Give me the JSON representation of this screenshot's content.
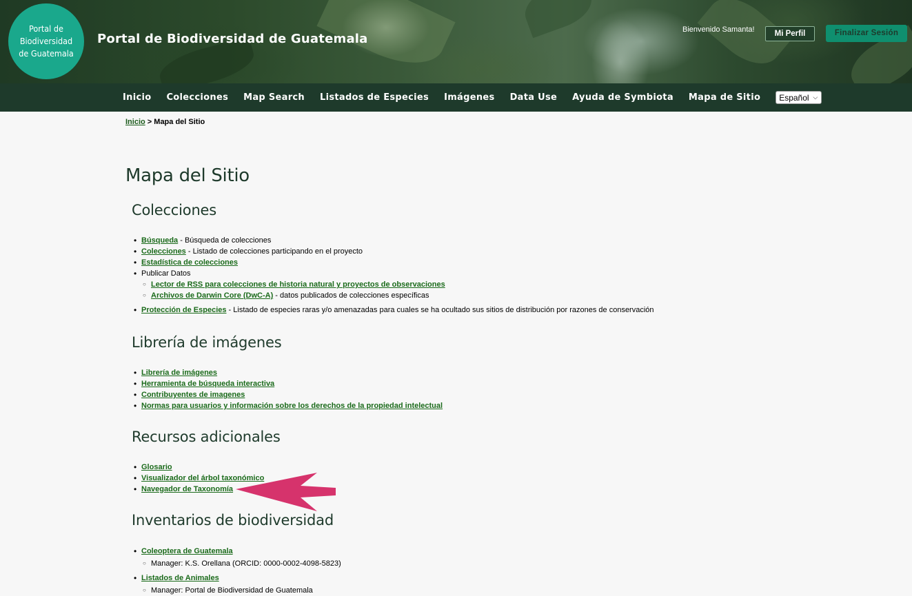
{
  "header": {
    "logo_text": "Portal de\nBiodiversidad\nde Guatemala",
    "site_title": "Portal de Biodiversidad de Guatemala",
    "welcome": "Bienvenido Samanta!",
    "profile_button": "Mi Perfil",
    "logout_button": "Finalizar Sesión"
  },
  "nav": {
    "items": [
      "Inicio",
      "Colecciones",
      "Map Search",
      "Listados de Especies",
      "Imágenes",
      "Data Use",
      "Ayuda de Symbiota",
      "Mapa de Sitio"
    ],
    "language": "Español"
  },
  "breadcrumb": {
    "home": "Inicio",
    "separator": " > ",
    "current": "Mapa del Sitio"
  },
  "page_title": "Mapa del Sitio",
  "sections": {
    "colecciones": {
      "title": "Colecciones",
      "busqueda": {
        "link": "Búsqueda",
        "desc": " - Búsqueda de colecciones"
      },
      "colecciones": {
        "link": "Colecciones",
        "desc": " - Listado de colecciones participando en el proyecto"
      },
      "estadistica": {
        "link": "Estadística de colecciones"
      },
      "publicar": "Publicar Datos",
      "rss": {
        "link": "Lector de RSS para colecciones de historia natural y proyectos de observaciones"
      },
      "dwca": {
        "link": "Archivos de Darwin Core (DwC-A)",
        "desc": " - datos publicados de colecciones específicas"
      },
      "proteccion": {
        "link": "Protección de Especies",
        "desc": " - Listado de especies raras y/o amenazadas para cuales se ha ocultado sus sitios de distribución por razones de conservación"
      }
    },
    "imagenes": {
      "title": "Librería de imágenes",
      "items": [
        "Librería de imágenes",
        "Herramienta de búsqueda interactiva",
        "Contribuyentes de imagenes",
        "Normas para usuarios y información sobre los derechos de la propiedad intelectual"
      ]
    },
    "recursos": {
      "title": "Recursos adicionales",
      "items": [
        "Glosario",
        "Visualizador del árbol taxonómico",
        "Navegador de Taxonomía"
      ]
    },
    "inventarios": {
      "title": "Inventarios de biodiversidad",
      "coleoptera": {
        "link": "Coleoptera de Guatemala",
        "manager": "Manager: K.S. Orellana (ORCID: 0000-0002-4098-5823)"
      },
      "animales": {
        "link": "Listados de Animales",
        "manager": "Manager: Portal de Biodiversidad de Guatemala"
      }
    }
  },
  "colors": {
    "nav_bg": "#1e3a2b",
    "logo_green": "#1aa88c",
    "link_green": "#1a6a1a",
    "arrow": "#d6336c"
  },
  "annotation": {
    "icon": "arrow-left-icon"
  }
}
